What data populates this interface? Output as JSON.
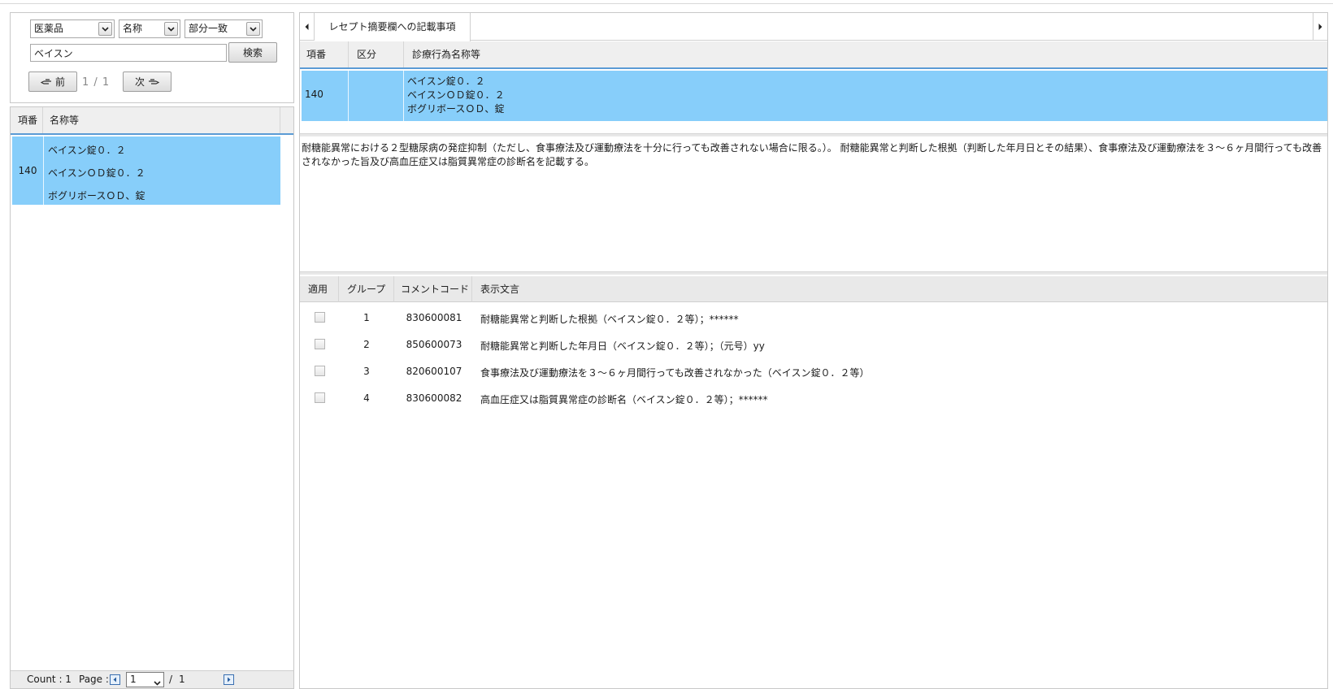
{
  "search": {
    "category": "医薬品",
    "field": "名称",
    "match": "部分一致",
    "keyword": "ベイスン",
    "search_label": "検索",
    "prev_label": "前",
    "next_label": "次",
    "page_indicator": "1 / 1"
  },
  "list": {
    "headers": [
      "項番",
      "名称等"
    ],
    "rows": [
      {
        "number": "140",
        "names": [
          "ベイスン錠０．２",
          "ベイスンＯＤ錠０．２",
          "ボグリボースＯＤ、錠"
        ]
      }
    ],
    "footer": {
      "count_label": "Count : 1",
      "page_label": "Page :",
      "page_value": "1",
      "page_separator": "/",
      "page_total": "1"
    }
  },
  "detail": {
    "tab_label": "レセプト摘要欄への記載事項",
    "headers": [
      "項番",
      "区分",
      "診療行為名称等"
    ],
    "row": {
      "number": "140",
      "category": "",
      "names": [
        "ベイスン錠０．２",
        "ベイスンＯＤ錠０．２",
        "ボグリボースＯＤ、錠"
      ]
    },
    "description": "耐糖能異常における２型糖尿病の発症抑制（ただし、食事療法及び運動療法を十分に行っても改善されない場合に限る。）。 耐糖能異常と判断した根拠（判断した年月日とその結果）、食事療法及び運動療法を３～６ヶ月間行っても改善されなかった旨及び高血圧症又は脂質異常症の診断名を記載する。"
  },
  "comments": {
    "headers": [
      "適用",
      "グループ",
      "コメントコード",
      "表示文言"
    ],
    "rows": [
      {
        "applied": false,
        "group": "1",
        "code": "830600081",
        "text": "耐糖能異常と判断した根拠（ベイスン錠０．２等）；******"
      },
      {
        "applied": false,
        "group": "2",
        "code": "850600073",
        "text": "耐糖能異常と判断した年月日（ベイスン錠０．２等）；（元号）yy"
      },
      {
        "applied": false,
        "group": "3",
        "code": "820600107",
        "text": "食事療法及び運動療法を３～６ヶ月間行っても改善されなかった（ベイスン錠０．２等）"
      },
      {
        "applied": false,
        "group": "4",
        "code": "830600082",
        "text": "高血圧症又は脂質異常症の診断名（ベイスン錠０．２等）；******"
      }
    ]
  },
  "colors": {
    "selection": "#87cefa",
    "header_bg": "#efefef",
    "accent_line": "#5b9bd5"
  }
}
